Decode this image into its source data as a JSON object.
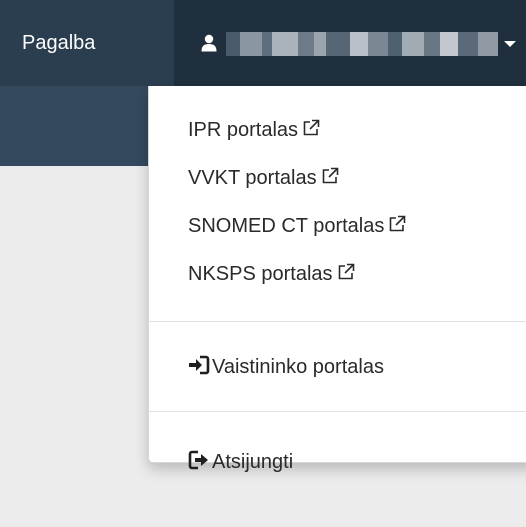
{
  "navbar": {
    "help_label": "Pagalba",
    "user_menu": {
      "username_blurred": true,
      "username_blur_colors": [
        "#4a5b6b",
        "#8a96a1",
        "#5e6e7c",
        "#aab3bb",
        "#6d7b88",
        "#9aa4ae",
        "#566674",
        "#b9c0c7",
        "#7b8894",
        "#4f606f",
        "#a1abb4",
        "#687784",
        "#c2c8ce",
        "#5a6a78",
        "#8f9aa5"
      ]
    }
  },
  "dropdown": {
    "portal_links": [
      {
        "label": "IPR portalas",
        "icon": "external-link-icon"
      },
      {
        "label": "VVKT portalas",
        "icon": "external-link-icon"
      },
      {
        "label": "SNOMED CT portalas",
        "icon": "external-link-icon"
      },
      {
        "label": "NKSPS portalas",
        "icon": "external-link-icon"
      }
    ],
    "pharmacist_portal": {
      "label": "Vaistininko portalas",
      "icon": "sign-in-icon"
    },
    "logout": {
      "label": "Atsijungti",
      "icon": "sign-out-icon"
    }
  },
  "colors": {
    "navbar_bg": "#2b3e50",
    "user_toggle_bg": "#1f2f3e",
    "subbar_bg": "#34495e",
    "page_bg": "#ececec",
    "menu_text": "#2a2a2a"
  }
}
